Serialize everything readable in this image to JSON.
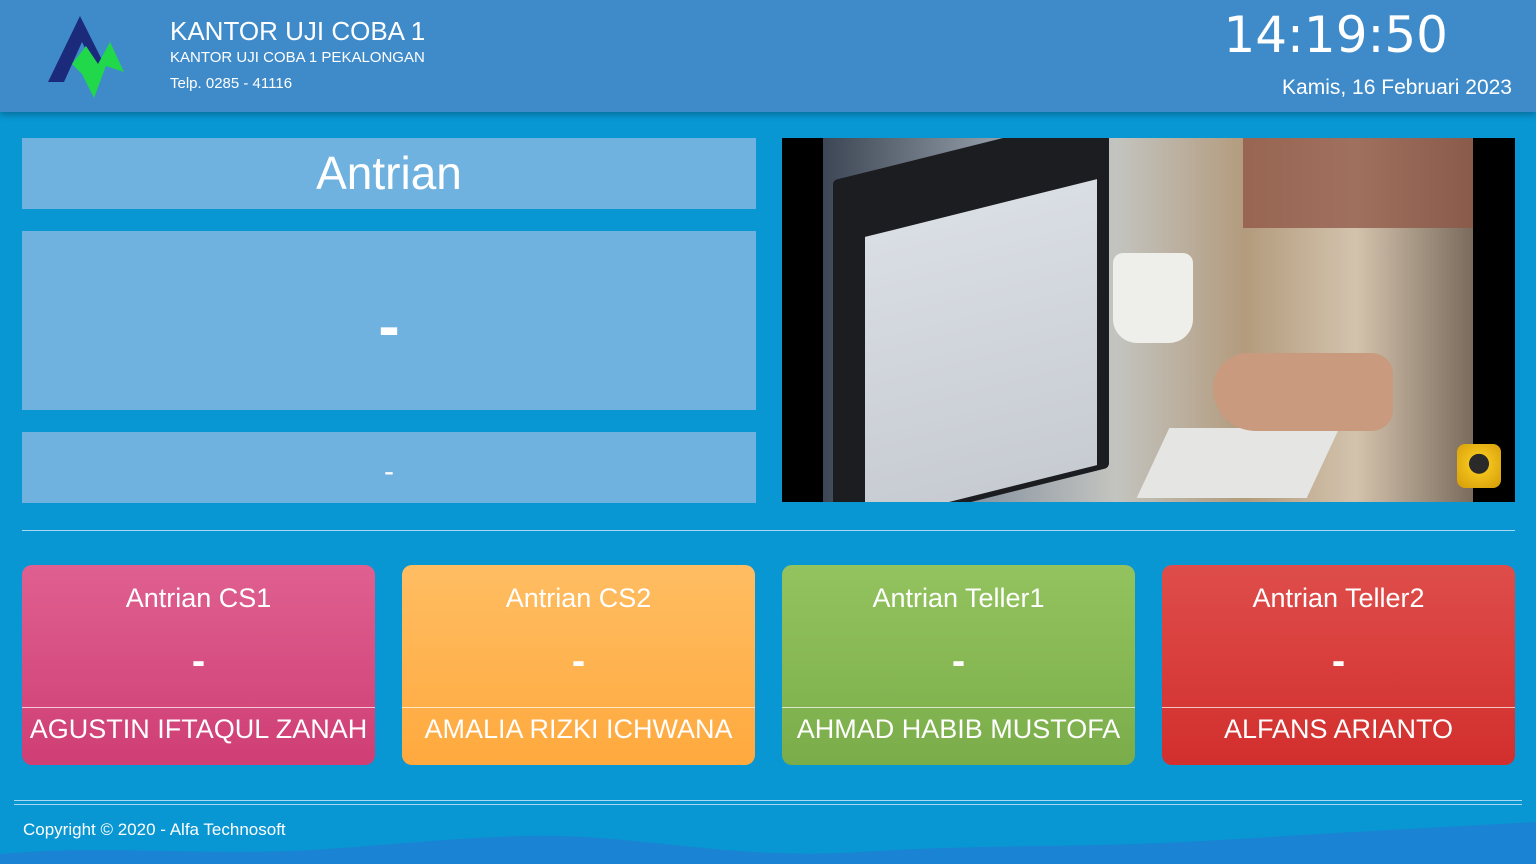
{
  "header": {
    "title": "KANTOR UJI COBA 1",
    "subtitle": "KANTOR UJI COBA 1 PEKALONGAN",
    "phone": "Telp. 0285 - 41116",
    "time": "14:19:50",
    "date": "Kamis, 16 Februari 2023"
  },
  "queue": {
    "title": "Antrian",
    "current_number": "-",
    "current_counter": "-"
  },
  "video": {
    "overlay_icon": "camera-icon"
  },
  "counters": [
    {
      "title": "Antrian CS1",
      "number": "-",
      "name": "AGUSTIN IFTAQUL ZANAH",
      "color": "#d84f83"
    },
    {
      "title": "Antrian CS2",
      "number": "-",
      "name": "AMALIA RIZKI ICHWANA",
      "color": "#ffb34f"
    },
    {
      "title": "Antrian Teller1",
      "number": "-",
      "name": "AHMAD HABIB MUSTOFA",
      "color": "#87b955"
    },
    {
      "title": "Antrian Teller2",
      "number": "-",
      "name": "ALFANS ARIANTO",
      "color": "#d83e3c"
    }
  ],
  "footer": {
    "copyright": "Copyright © 2020 - Alfa Technosoft"
  }
}
